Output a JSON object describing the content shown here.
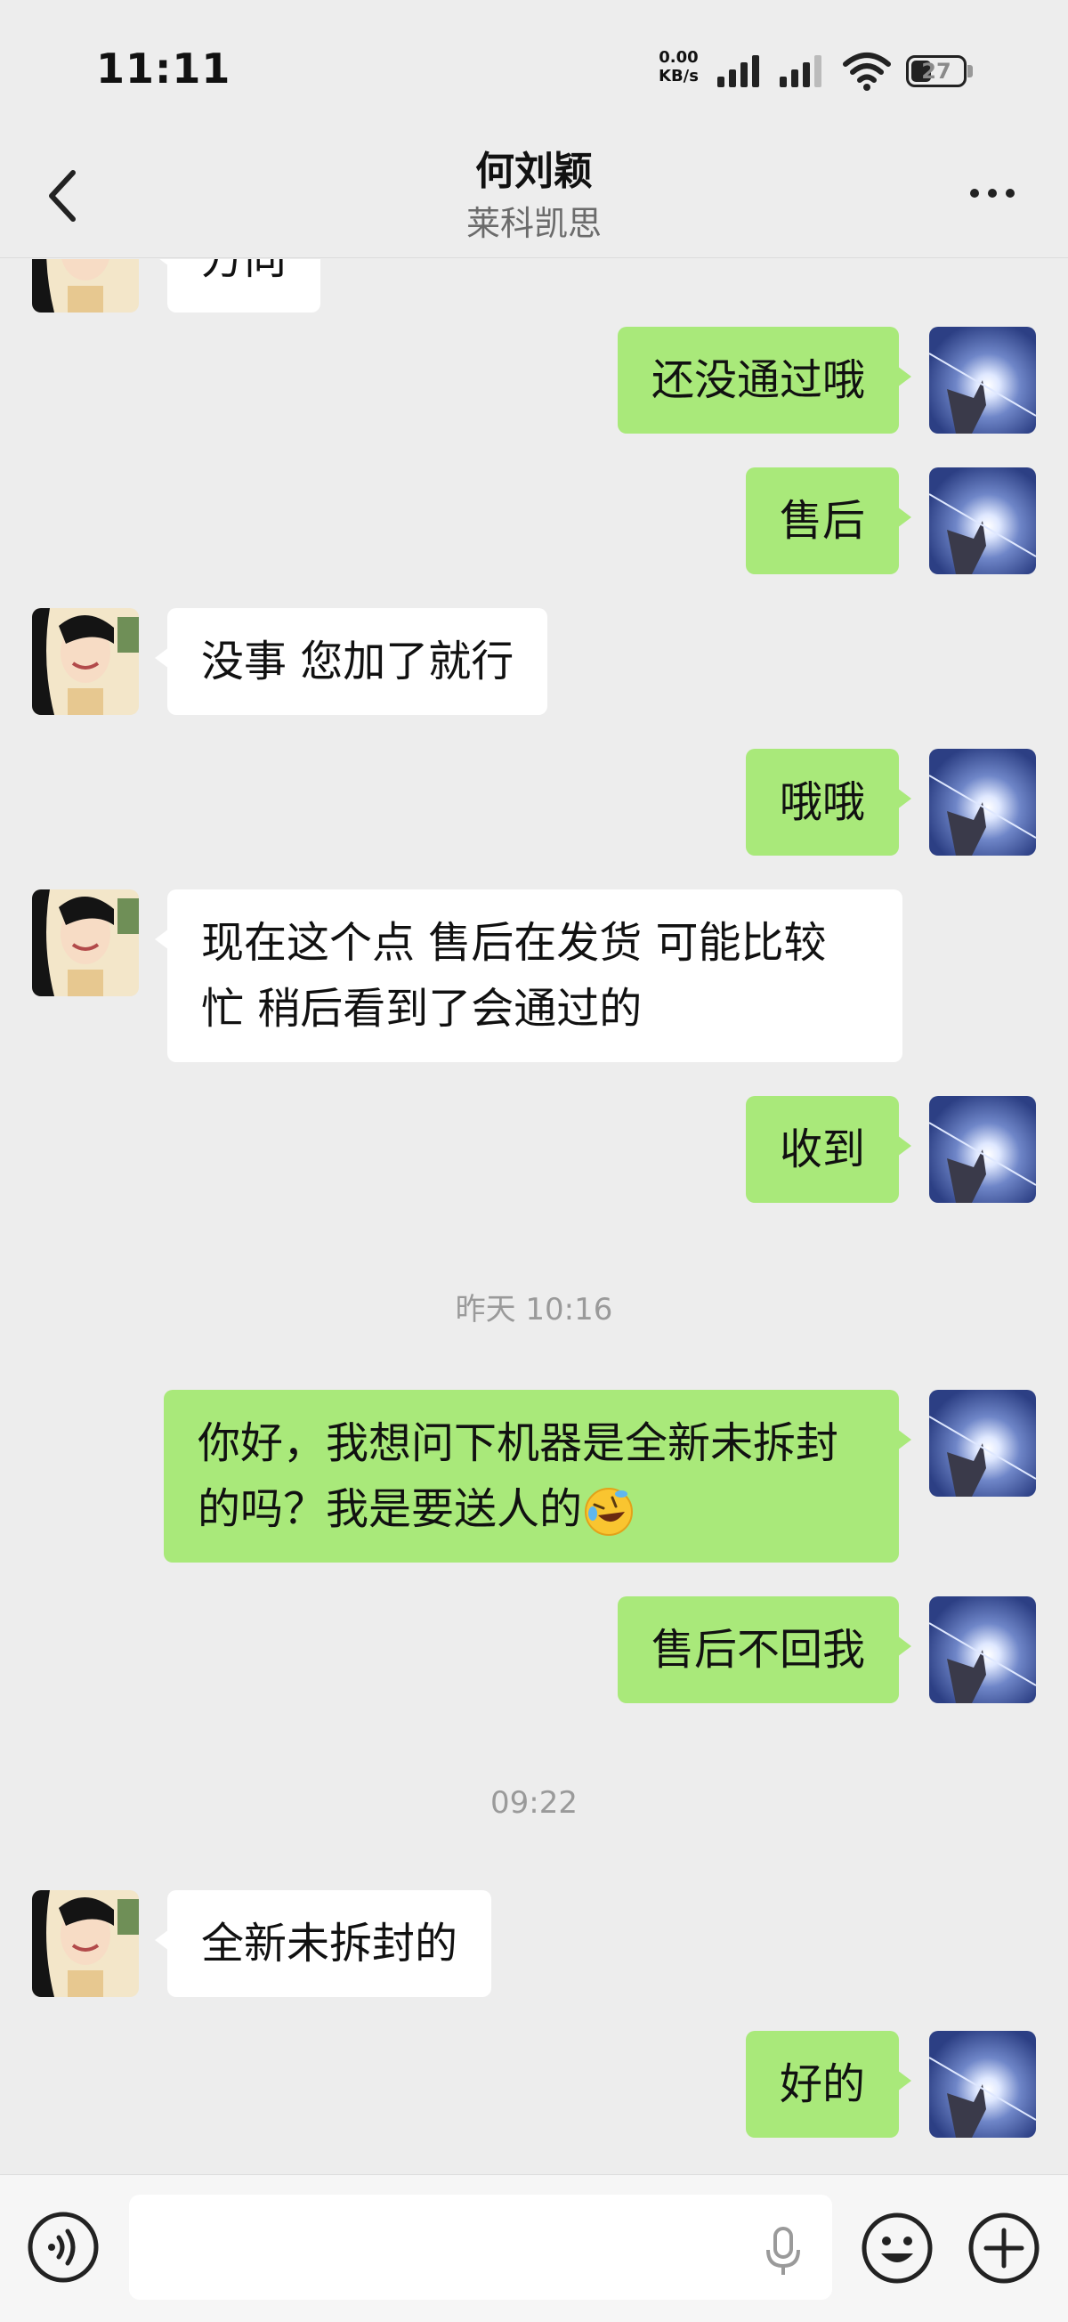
{
  "status_bar": {
    "time": "11:11",
    "net_speed_value": "0.00",
    "net_speed_unit": "KB/s",
    "battery": "27"
  },
  "header": {
    "title": "何刘颖",
    "subtitle": "莱科凯思"
  },
  "messages": [
    {
      "side": "left",
      "text": "方向"
    },
    {
      "side": "right",
      "text": "还没通过哦"
    },
    {
      "side": "right",
      "text": "售后"
    },
    {
      "side": "left",
      "text": "没事 您加了就行"
    },
    {
      "side": "right",
      "text": "哦哦"
    },
    {
      "side": "left",
      "line1": "现在这个点 售后在发货 可能比较",
      "line2": "忙 稍后看到了会通过的"
    },
    {
      "side": "right",
      "text": "收到"
    },
    {
      "type": "timestamp",
      "text": "昨天 10:16"
    },
    {
      "side": "right",
      "line1": "你好，我想问下机器是全新未拆封",
      "line2": "的吗？我是要送人的",
      "emoji": "rolling-on-floor-laughing"
    },
    {
      "side": "right",
      "text": "售后不回我"
    },
    {
      "type": "timestamp",
      "text": "09:22"
    },
    {
      "side": "left",
      "text": "全新未拆封的"
    },
    {
      "side": "right",
      "text": "好的"
    }
  ],
  "input": {
    "value": "",
    "placeholder": ""
  },
  "icons": {
    "back": "chevron-left-icon",
    "more": "more-dots-icon",
    "voice": "voice-icon",
    "mic": "microphone-icon",
    "emoji": "emoji-icon",
    "plus": "plus-icon"
  },
  "colors": {
    "background": "#ededed",
    "own_bubble": "#a9e97a",
    "other_bubble": "#ffffff"
  }
}
